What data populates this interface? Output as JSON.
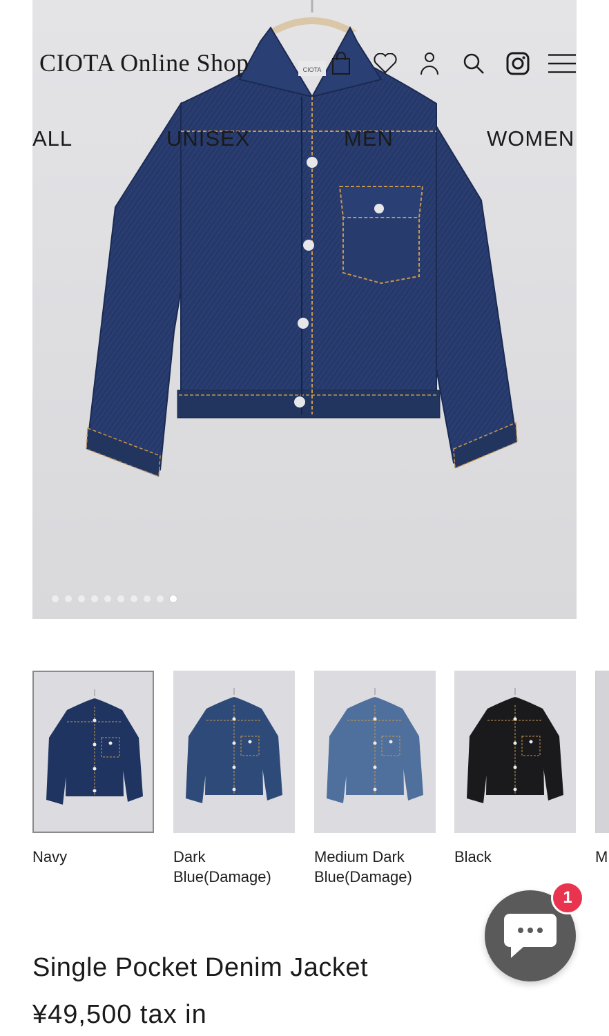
{
  "header": {
    "logo": "CIOTA Online Shop",
    "icons": [
      "bag-icon",
      "heart-icon",
      "user-icon",
      "search-icon",
      "instagram-icon",
      "menu-icon"
    ]
  },
  "nav": [
    {
      "label": "ALL"
    },
    {
      "label": "UNISEX"
    },
    {
      "label": "MEN"
    },
    {
      "label": "WOMEN"
    }
  ],
  "hero": {
    "tag_text": "CIOTA",
    "carousel_total": 10,
    "carousel_active": 10
  },
  "variants": [
    {
      "label": "Navy",
      "color": "#1f3460",
      "selected": true
    },
    {
      "label": "Dark\nBlue(Damage)",
      "color": "#2d4a79",
      "selected": false
    },
    {
      "label": "Medium Dark\nBlue(Damage)",
      "color": "#4f6f9c",
      "selected": false
    },
    {
      "label": "Black",
      "color": "#1a1a1c",
      "selected": false
    },
    {
      "label": "M",
      "color": "#d4d4d8",
      "selected": false
    }
  ],
  "product": {
    "title": "Single Pocket Denim Jacket",
    "price": "¥49,500 tax in"
  },
  "chat": {
    "badge": "1"
  },
  "colors": {
    "denim": "#243866",
    "stitch": "#c9974b",
    "background": "#dfdfe2",
    "badge": "#e8344f"
  }
}
